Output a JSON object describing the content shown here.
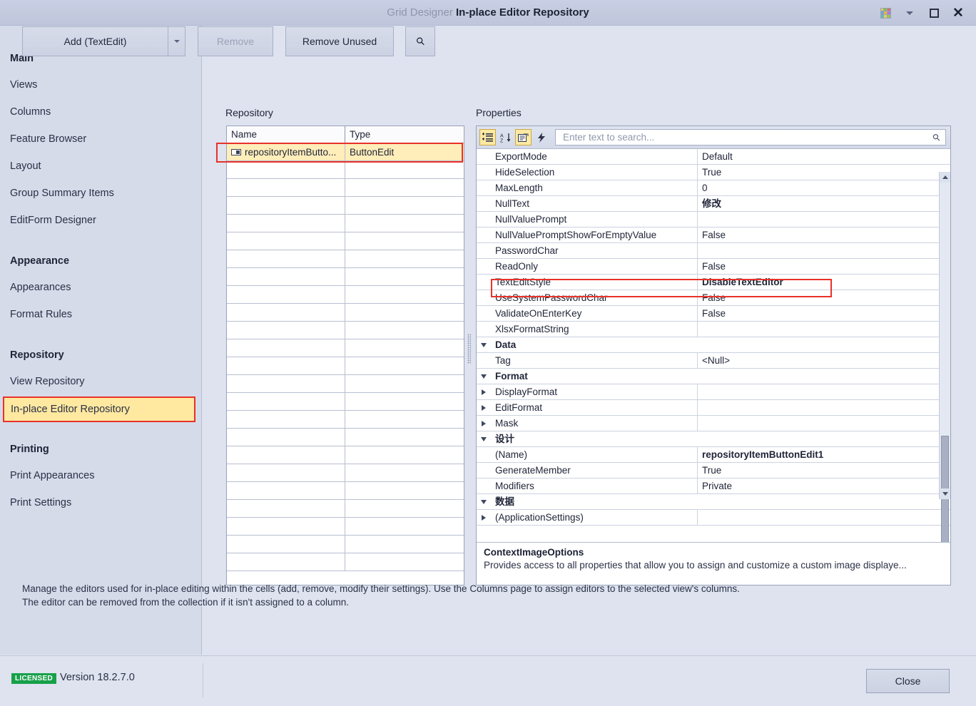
{
  "window": {
    "title_prefix": "Grid Designer",
    "title_main": "In-place Editor Repository",
    "buttons": {
      "grid_icon": "grid-icon",
      "dropdown_icon": "chevron-down-icon",
      "maximize_icon": "maximize-icon",
      "close_icon": "close-icon"
    }
  },
  "sidebar": {
    "groups": [
      {
        "label": "Main",
        "items": [
          "Views",
          "Columns",
          "Feature Browser",
          "Layout",
          "Group Summary Items",
          "EditForm Designer"
        ]
      },
      {
        "label": "Appearance",
        "items": [
          "Appearances",
          "Format Rules"
        ]
      },
      {
        "label": "Repository",
        "items": [
          "View Repository",
          "In-place Editor Repository"
        ]
      },
      {
        "label": "Printing",
        "items": [
          "Print Appearances",
          "Print Settings"
        ]
      }
    ],
    "active_item": "In-place Editor Repository"
  },
  "toolbar": {
    "add_label": "Add (TextEdit)",
    "add_dropdown_icon": "chevron-down-icon",
    "remove_label": "Remove",
    "remove_unused_label": "Remove Unused",
    "search_icon": "search-icon"
  },
  "repository": {
    "label": "Repository",
    "columns": [
      "Name",
      "Type"
    ],
    "rows": [
      {
        "icon": "textedit-icon",
        "name": "repositoryItemButto...",
        "type": "ButtonEdit",
        "selected": true
      }
    ],
    "empty_row_count": 23
  },
  "properties": {
    "label": "Properties",
    "toolbar_icons": [
      {
        "name": "categorized-view-icon",
        "glyph": "≣",
        "active": true
      },
      {
        "name": "alphabetical-sort-icon",
        "glyph": "A↓",
        "active": false
      },
      {
        "name": "property-pages-icon",
        "glyph": "▤",
        "active": true
      },
      {
        "name": "events-lightning-icon",
        "glyph": "⚡",
        "active": false
      }
    ],
    "search_placeholder": "Enter text to search...",
    "search_value": "",
    "search_icon": "search-icon",
    "rows": [
      {
        "kind": "prop",
        "name": "ExportMode",
        "value": "Default",
        "bold": false,
        "expandable": false
      },
      {
        "kind": "prop",
        "name": "HideSelection",
        "value": "True",
        "bold": false,
        "expandable": false
      },
      {
        "kind": "prop",
        "name": "MaxLength",
        "value": "0",
        "bold": false,
        "expandable": false
      },
      {
        "kind": "prop",
        "name": "NullText",
        "value": "修改",
        "bold": true,
        "expandable": false
      },
      {
        "kind": "prop",
        "name": "NullValuePrompt",
        "value": "",
        "bold": false,
        "expandable": false
      },
      {
        "kind": "prop",
        "name": "NullValuePromptShowForEmptyValue",
        "value": "False",
        "bold": false,
        "expandable": false
      },
      {
        "kind": "prop",
        "name": "PasswordChar",
        "value": "",
        "bold": false,
        "expandable": false
      },
      {
        "kind": "prop",
        "name": "ReadOnly",
        "value": "False",
        "bold": false,
        "expandable": false
      },
      {
        "kind": "prop",
        "name": "TextEditStyle",
        "value": "DisableTextEditor",
        "bold": true,
        "expandable": false,
        "highlighted": true
      },
      {
        "kind": "prop",
        "name": "UseSystemPasswordChar",
        "value": "False",
        "bold": false,
        "expandable": false
      },
      {
        "kind": "prop",
        "name": "ValidateOnEnterKey",
        "value": "False",
        "bold": false,
        "expandable": false
      },
      {
        "kind": "prop",
        "name": "XlsxFormatString",
        "value": "",
        "bold": false,
        "expandable": false
      },
      {
        "kind": "category",
        "name": "Data",
        "value": "",
        "expanded": true
      },
      {
        "kind": "prop",
        "name": "Tag",
        "value": "<Null>",
        "bold": false,
        "expandable": false
      },
      {
        "kind": "category",
        "name": "Format",
        "value": "",
        "expanded": true
      },
      {
        "kind": "prop",
        "name": "DisplayFormat",
        "value": "",
        "bold": false,
        "expandable": true
      },
      {
        "kind": "prop",
        "name": "EditFormat",
        "value": "",
        "bold": false,
        "expandable": true
      },
      {
        "kind": "prop",
        "name": "Mask",
        "value": "",
        "bold": false,
        "expandable": true
      },
      {
        "kind": "category",
        "name": "设计",
        "value": "",
        "expanded": true
      },
      {
        "kind": "prop",
        "name": "(Name)",
        "value": "repositoryItemButtonEdit1",
        "bold": true,
        "expandable": false
      },
      {
        "kind": "prop",
        "name": "GenerateMember",
        "value": "True",
        "bold": false,
        "expandable": false
      },
      {
        "kind": "prop",
        "name": "Modifiers",
        "value": "Private",
        "bold": false,
        "expandable": false
      },
      {
        "kind": "category",
        "name": "数据",
        "value": "",
        "expanded": true
      },
      {
        "kind": "prop",
        "name": "(ApplicationSettings)",
        "value": "",
        "bold": false,
        "expandable": true
      }
    ],
    "description": {
      "title": "ContextImageOptions",
      "body": "Provides access to all properties that allow you to assign and customize a custom image displaye..."
    }
  },
  "footer": {
    "description": "Manage the editors used for in-place editing within the cells (add, remove, modify their settings). Use the Columns page to assign editors to the selected view's columns. The editor can be removed from the collection if it isn't assigned to a column."
  },
  "statusbar": {
    "license_badge": "LICENSED",
    "version": "Version 18.2.7.0",
    "close_label": "Close"
  },
  "colors": {
    "accent_red": "#e8322a",
    "highlight_yellow": "#ffe8a0",
    "license_green": "#17a04a",
    "chrome": "#dee3ef"
  }
}
